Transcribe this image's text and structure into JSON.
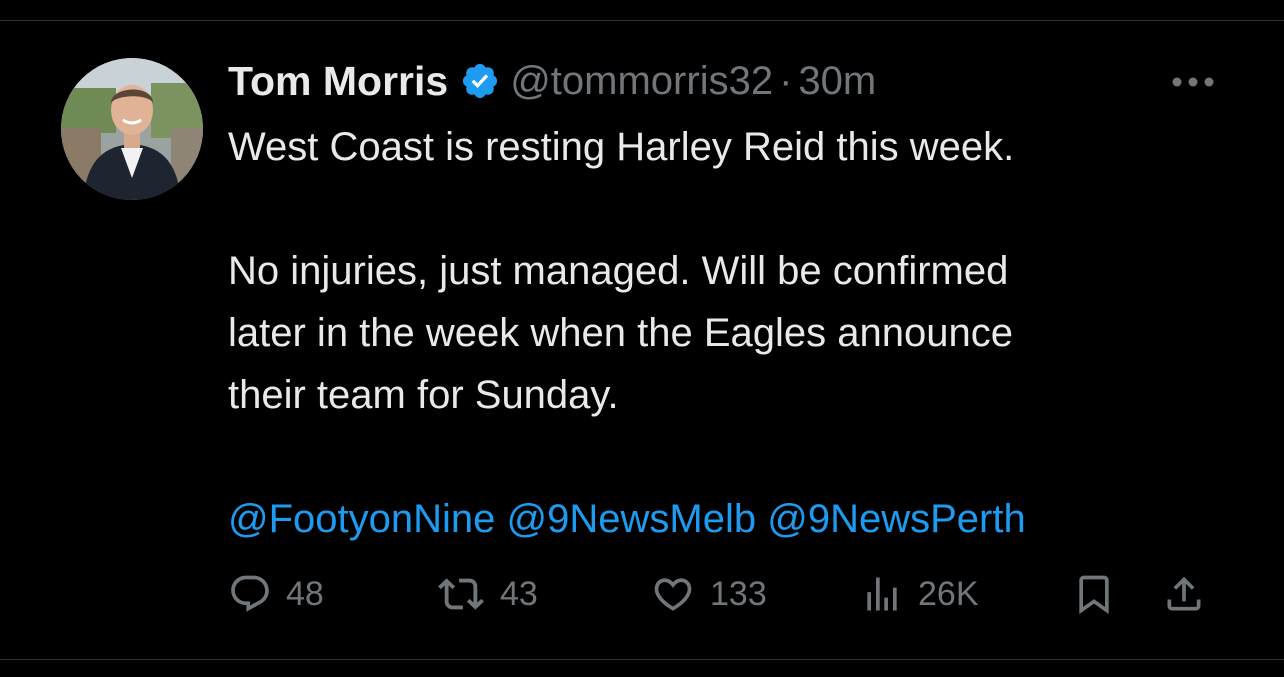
{
  "tweet": {
    "author": {
      "display_name": "Tom Morris",
      "handle": "@tommorris32",
      "verified": true
    },
    "separator": "·",
    "time": "30m",
    "paragraphs": [
      "West Coast is resting Harley Reid this week.",
      "No injuries, just managed. Will be confirmed\nlater in the week when the Eagles announce\ntheir team for Sunday."
    ],
    "mentions": [
      "@FootyonNine",
      "@9NewsMelb",
      "@9NewsPerth"
    ],
    "metrics": {
      "replies": "48",
      "reposts": "43",
      "likes": "133",
      "views": "26K"
    }
  },
  "icons": {
    "verified": "verified-badge-icon",
    "more": "more-dots-icon",
    "reply": "reply-icon",
    "repost": "repost-icon",
    "like": "heart-icon",
    "views": "views-chart-icon",
    "bookmark": "bookmark-icon",
    "share": "share-icon"
  },
  "colors": {
    "background": "#000000",
    "text": "#e7e9ea",
    "secondary": "#71767b",
    "link": "#1d9bf0",
    "verified": "#1d9bf0"
  }
}
